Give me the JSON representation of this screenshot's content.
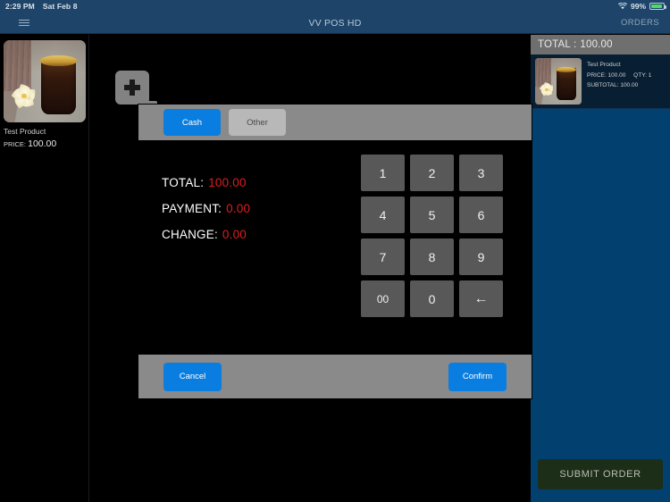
{
  "statusbar": {
    "time": "2:29 PM",
    "date": "Sat Feb 8",
    "battery_percent": "99%",
    "wifi_icon": "wifi-icon",
    "battery_icon": "battery-icon"
  },
  "navbar": {
    "menu_icon": "hamburger-menu-icon",
    "title": "VV POS HD",
    "orders_label": "ORDERS"
  },
  "products": {
    "items": [
      {
        "name": "Test Product",
        "price_label": "PRICE:",
        "price": "100.00",
        "image": "iced-coffee-with-flower-photo"
      }
    ]
  },
  "main": {
    "add_icon": "add-product-icon"
  },
  "order_panel": {
    "total_label": "TOTAL :",
    "total_amount": "100.00",
    "items": [
      {
        "name": "Test Product",
        "price_text": "PRICE: 100.00",
        "qty_text": "QTY: 1",
        "subtotal_text": "SUBTOTAL: 100.00",
        "image": "iced-coffee-with-flower-photo"
      }
    ],
    "submit_label": "SUBMIT ORDER"
  },
  "payment_dialog": {
    "tabs": [
      {
        "label": "Cash",
        "active": true
      },
      {
        "label": "Other",
        "active": false
      }
    ],
    "summary": [
      {
        "label": "TOTAL:",
        "value": "100.00"
      },
      {
        "label": "PAYMENT:",
        "value": "0.00"
      },
      {
        "label": "CHANGE:",
        "value": "0.00"
      }
    ],
    "keypad": [
      "1",
      "2",
      "3",
      "4",
      "5",
      "6",
      "7",
      "8",
      "9",
      "00",
      "0",
      "←"
    ],
    "backspace_icon": "backspace-arrow-icon",
    "cancel_label": "Cancel",
    "confirm_label": "Confirm"
  },
  "colors": {
    "navbar": "#1e4469",
    "order_panel": "#024070",
    "accent_blue": "#0a7ee0",
    "dialog_chrome": "#8a8a8a",
    "key": "#585858",
    "value_red": "#e01d1d",
    "submit_green": "#1d2e18",
    "battery_green": "#4cd964"
  }
}
